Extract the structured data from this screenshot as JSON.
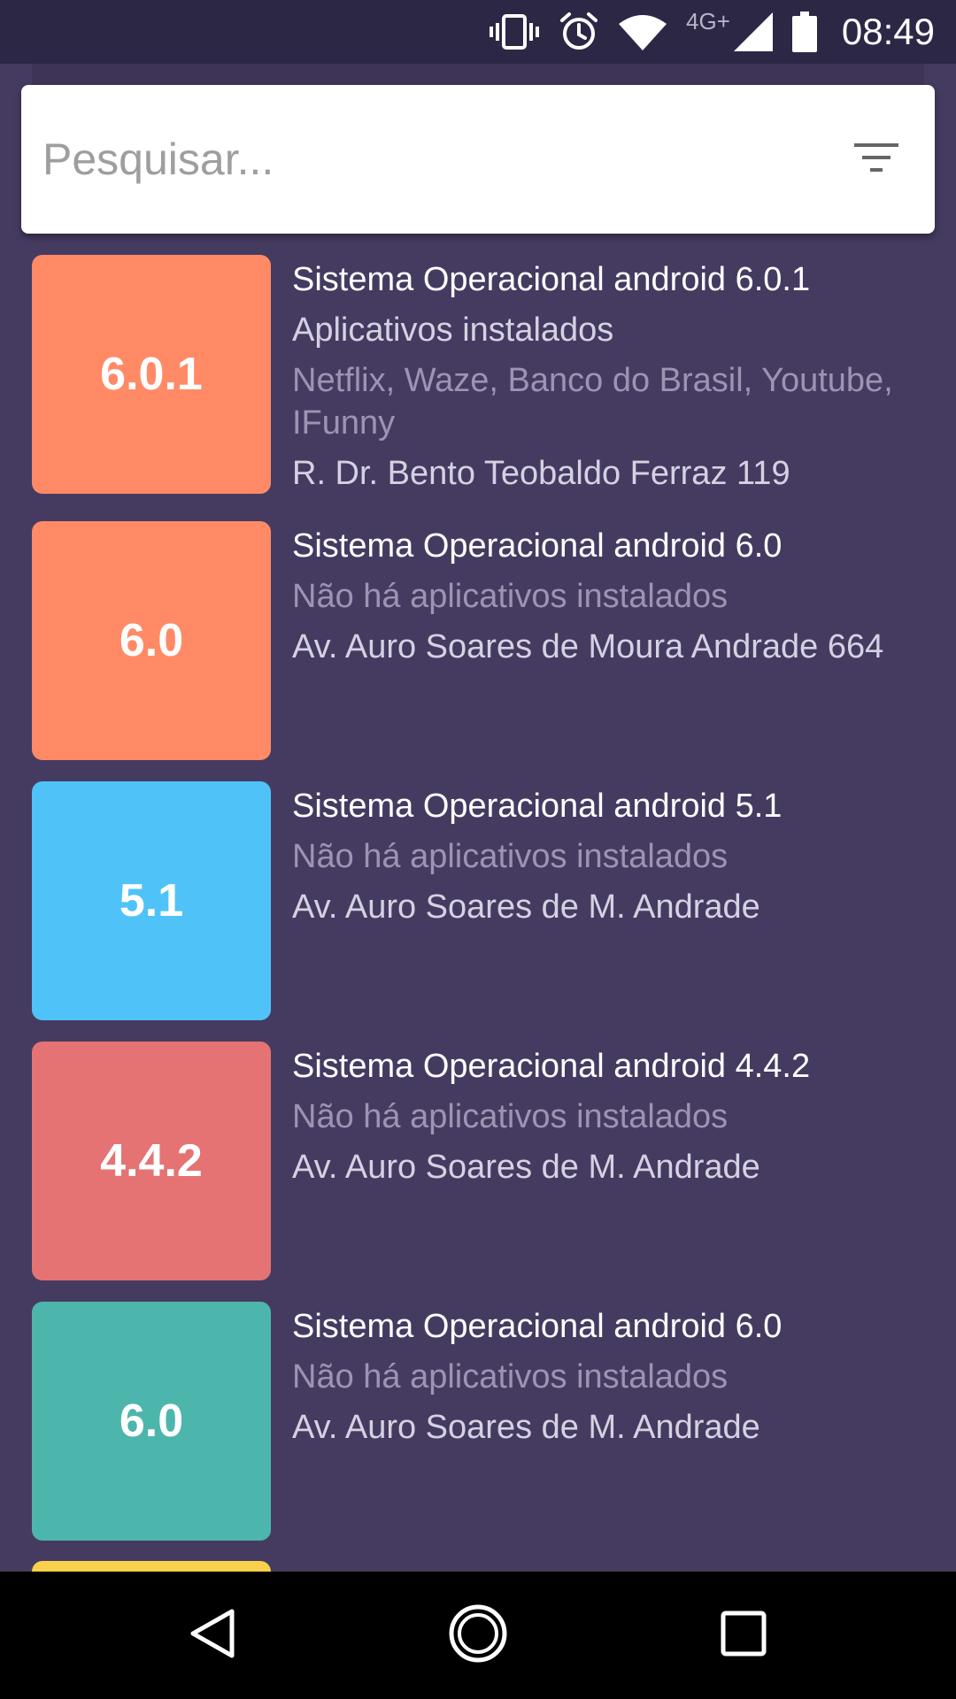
{
  "status_bar": {
    "network_type": "4G+",
    "time": "08:49",
    "icons": [
      "vibrate-icon",
      "alarm-icon",
      "wifi-icon",
      "signal-icon",
      "battery-icon"
    ]
  },
  "search": {
    "placeholder": "Pesquisar...",
    "value": "",
    "filter_icon": "filter-icon"
  },
  "items": [
    {
      "version": "6.0.1",
      "tile_color": "#ff8a65",
      "title": "Sistema Operacional android 6.0.1",
      "apps_label": "Aplicativos instalados",
      "apps_list": "Netflix, Waze, Banco do Brasil, Youtube, IFunny",
      "address": "R. Dr. Bento Teobaldo Ferraz  119"
    },
    {
      "version": "6.0",
      "tile_color": "#ff8a65",
      "title": "Sistema Operacional android 6.0",
      "apps_label": "Não há aplicativos instalados",
      "address": "Av. Auro Soares de Moura Andrade 664"
    },
    {
      "version": "5.1",
      "tile_color": "#4fc3f7",
      "title": "Sistema Operacional android 5.1",
      "apps_label": "Não há aplicativos instalados",
      "address": "Av. Auro Soares de M. Andrade"
    },
    {
      "version": "4.4.2",
      "tile_color": "#e57373",
      "title": "Sistema Operacional android 4.4.2",
      "apps_label": "Não há aplicativos instalados",
      "address": "Av. Auro Soares de M. Andrade"
    },
    {
      "version": "6.0",
      "tile_color": "#4db6ac",
      "title": "Sistema Operacional android 6.0",
      "apps_label": "Não há aplicativos instalados",
      "address": "Av. Auro Soares de M. Andrade"
    }
  ],
  "partial_item": {
    "tile_color": "#f9d14c"
  },
  "nav_bar": {
    "icons": [
      "back-icon",
      "home-icon",
      "recents-icon"
    ]
  }
}
